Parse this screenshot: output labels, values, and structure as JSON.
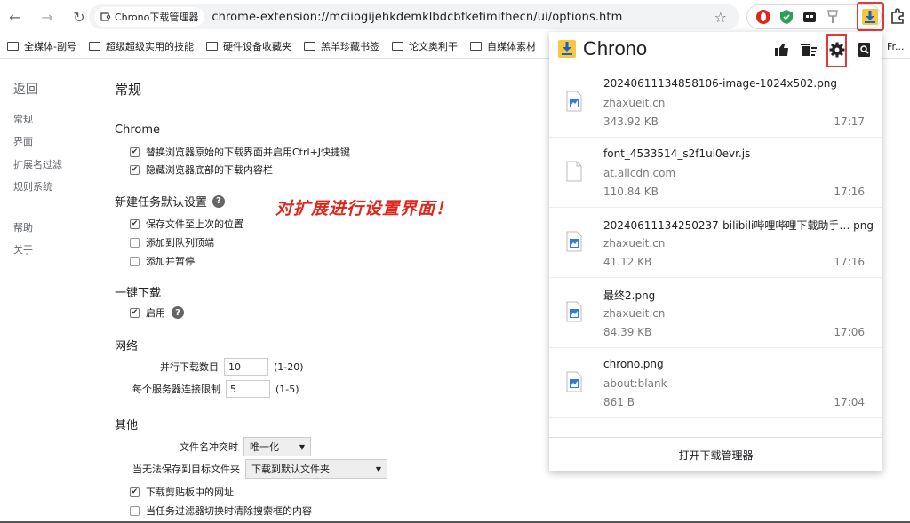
{
  "toolbar": {
    "site_chip": "Chrono下载管理器",
    "url": "chrome-extension://mciiogijehkdemklbdcbfkefimifhecn/ui/options.htm"
  },
  "bookmarks": [
    "全媒体-副号",
    "超级超级实用的技能",
    "硬件设备收藏夹",
    "羔羊珍藏书签",
    "论文奥利干",
    "自媒体素材"
  ],
  "bookmarks_overflow": "Fr...",
  "nav": {
    "back": "返回",
    "items": [
      "常规",
      "界面",
      "扩展名过滤",
      "规则系统"
    ],
    "items2": [
      "帮助",
      "关于"
    ]
  },
  "page_title": "常规",
  "sections": {
    "chrome": {
      "title": "Chrome",
      "opt1": "替换浏览器原始的下载界面并启用Ctrl+J快捷键",
      "opt2": "隐藏浏览器底部的下载内容栏"
    },
    "newtask": {
      "title": "新建任务默认设置",
      "opt1": "保存文件至上次的位置",
      "opt2": "添加到队列顶端",
      "opt3": "添加并暂停"
    },
    "oneclick": {
      "title": "一键下载",
      "opt1": "启用"
    },
    "network": {
      "title": "网络",
      "concurrent_label": "并行下载数目",
      "concurrent_value": "10",
      "concurrent_range": "(1-20)",
      "perserver_label": "每个服务器连接限制",
      "perserver_value": "5",
      "perserver_range": "(1-5)"
    },
    "other": {
      "title": "其他",
      "conflict_label": "文件名冲突时",
      "conflict_value": "唯一化",
      "fallback_label": "当无法保存到目标文件夹",
      "fallback_value": "下载到默认文件夹",
      "opt1": "下载剪贴板中的网址",
      "opt2": "当任务过滤器切换时清除搜索框的内容"
    }
  },
  "annotation": "对扩展进行设置界面！",
  "popup": {
    "title": "Chrono",
    "footer": "打开下载管理器",
    "items": [
      {
        "name": "20240611134858106-image-1024x502.png",
        "host": "zhaxueit.cn",
        "size": "343.92 KB",
        "time": "17:17",
        "type": "image"
      },
      {
        "name": "font_4533514_s2f1ui0evr.js",
        "host": "at.alicdn.com",
        "size": "110.84 KB",
        "time": "17:16",
        "type": "file"
      },
      {
        "name": "20240611134250237-bilibili哔哩哔哩下载助手…  png",
        "host": "zhaxueit.cn",
        "size": "41.12 KB",
        "time": "17:16",
        "type": "image"
      },
      {
        "name": "最终2.png",
        "host": "zhaxueit.cn",
        "size": "84.39 KB",
        "time": "17:06",
        "type": "image"
      },
      {
        "name": "chrono.png",
        "host": "about:blank",
        "size": "861 B",
        "time": "17:04",
        "type": "image"
      }
    ]
  }
}
